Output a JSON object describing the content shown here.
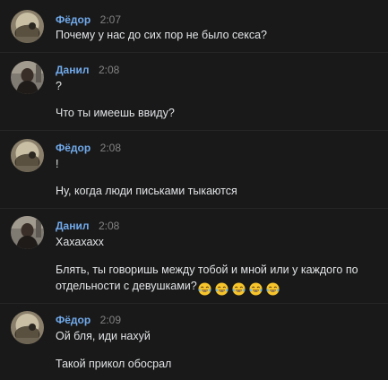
{
  "colors": {
    "background": "#191919",
    "author": "#71aaeb",
    "time": "#828282",
    "text": "#e1e3e6"
  },
  "messages": [
    {
      "author": "Фёдор",
      "time": "2:07",
      "avatar": "avatar-fedor",
      "lines": [
        "Почему у нас до сих пор не было секса?"
      ]
    },
    {
      "author": "Данил",
      "time": "2:08",
      "avatar": "avatar-danil",
      "lines": [
        "?",
        "Что ты имеешь ввиду?"
      ]
    },
    {
      "author": "Фёдор",
      "time": "2:08",
      "avatar": "avatar-fedor",
      "lines": [
        "!",
        "Ну, когда люди письками тыкаются"
      ]
    },
    {
      "author": "Данил",
      "time": "2:08",
      "avatar": "avatar-danil",
      "lines": [
        "Хахахахх",
        "Блять, ты говоришь между тобой и мной или у каждого по",
        "отдельности с девушками?"
      ],
      "emoji": [
        "tears-of-joy",
        "tears-of-joy",
        "tears-of-joy",
        "tears-of-joy",
        "tears-of-joy"
      ]
    },
    {
      "author": "Фёдор",
      "time": "2:09",
      "avatar": "avatar-fedor",
      "lines": [
        "Ой бля, иди нахуй",
        "Такой прикол обосрал"
      ]
    }
  ]
}
